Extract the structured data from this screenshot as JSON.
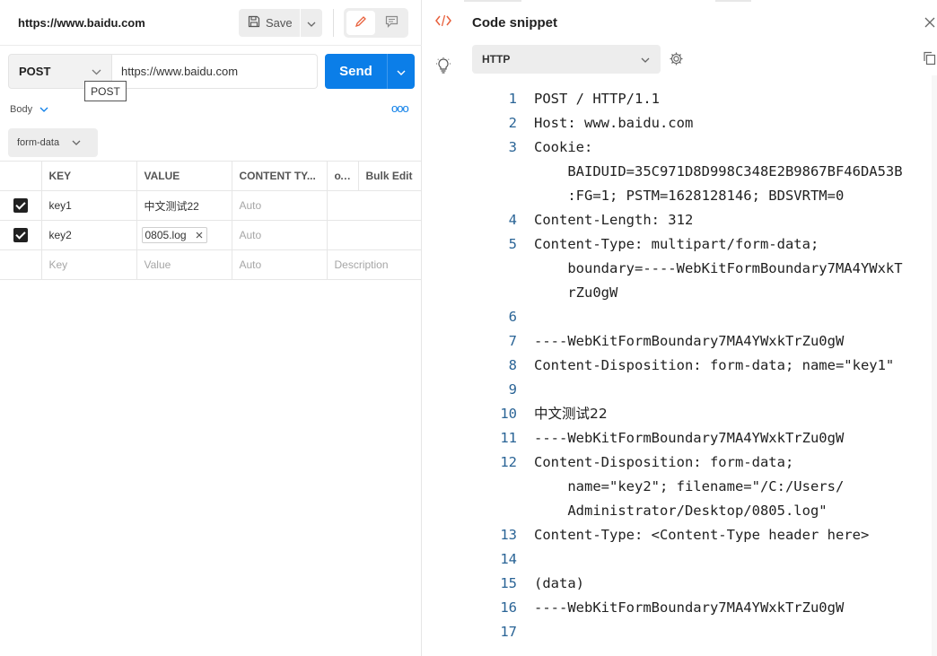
{
  "request": {
    "title": "https://www.baidu.com",
    "save_label": "Save",
    "method": "POST",
    "method_tooltip": "POST",
    "url": "https://www.baidu.com",
    "send_label": "Send"
  },
  "body": {
    "tab_label": "Body",
    "mode_label": "form-data",
    "more": "ooo",
    "columns": {
      "key": "KEY",
      "value": "VALUE",
      "content_type": "CONTENT TY...",
      "dots": "ooo",
      "bulk_edit": "Bulk Edit"
    },
    "rows": [
      {
        "checked": true,
        "key": "key1",
        "value": "中文测试22",
        "content_type": "Auto",
        "description": ""
      },
      {
        "checked": true,
        "key": "key2",
        "value": "0805.log",
        "content_type": "Auto",
        "description": ""
      }
    ],
    "placeholder_row": {
      "key": "Key",
      "value": "Value",
      "content_type": "Auto",
      "description": "Description"
    }
  },
  "snippet": {
    "title": "Code snippet",
    "language": "HTTP",
    "lines": [
      {
        "num": "1",
        "parts": [
          "POST / HTTP/1.1"
        ]
      },
      {
        "num": "2",
        "parts": [
          "Host: www.baidu.com"
        ]
      },
      {
        "num": "3",
        "parts": [
          "Cookie:",
          "    BAIDUID=35C971D8D998C348E2B9867BF46DA53B",
          "    :FG=1; PSTM=1628128146; BDSVRTM=0"
        ]
      },
      {
        "num": "4",
        "parts": [
          "Content-Length: 312"
        ]
      },
      {
        "num": "5",
        "parts": [
          "Content-Type: multipart/form-data;",
          "    boundary=----WebKitFormBoundary7MA4YWxkT",
          "    rZu0gW"
        ]
      },
      {
        "num": "6",
        "parts": [
          ""
        ]
      },
      {
        "num": "7",
        "parts": [
          "----WebKitFormBoundary7MA4YWxkTrZu0gW"
        ]
      },
      {
        "num": "8",
        "parts": [
          "Content-Disposition: form-data; name=\"key1\""
        ]
      },
      {
        "num": "9",
        "parts": [
          ""
        ]
      },
      {
        "num": "10",
        "parts": [
          "中文测试22"
        ],
        "cn": true
      },
      {
        "num": "11",
        "parts": [
          "----WebKitFormBoundary7MA4YWxkTrZu0gW"
        ]
      },
      {
        "num": "12",
        "parts": [
          "Content-Disposition: form-data;",
          "    name=\"key2\"; filename=\"/C:/Users/",
          "    Administrator/Desktop/0805.log\""
        ]
      },
      {
        "num": "13",
        "parts": [
          "Content-Type: <Content-Type header here>"
        ]
      },
      {
        "num": "14",
        "parts": [
          ""
        ]
      },
      {
        "num": "15",
        "parts": [
          "(data)"
        ]
      },
      {
        "num": "16",
        "parts": [
          "----WebKitFormBoundary7MA4YWxkTrZu0gW"
        ]
      },
      {
        "num": "17",
        "parts": [
          ""
        ]
      }
    ]
  },
  "icons": {
    "save": "save-icon",
    "edit": "pencil-icon",
    "comment": "comment-icon",
    "code": "code-icon",
    "bulb": "lightbulb-icon",
    "settings": "gear-icon",
    "copy": "copy-icon",
    "close": "close-icon"
  },
  "colors": {
    "accent": "#0b7ee8",
    "edit_icon": "#e8603c",
    "code_icon": "#e8603c",
    "line_number": "#2a6496"
  }
}
